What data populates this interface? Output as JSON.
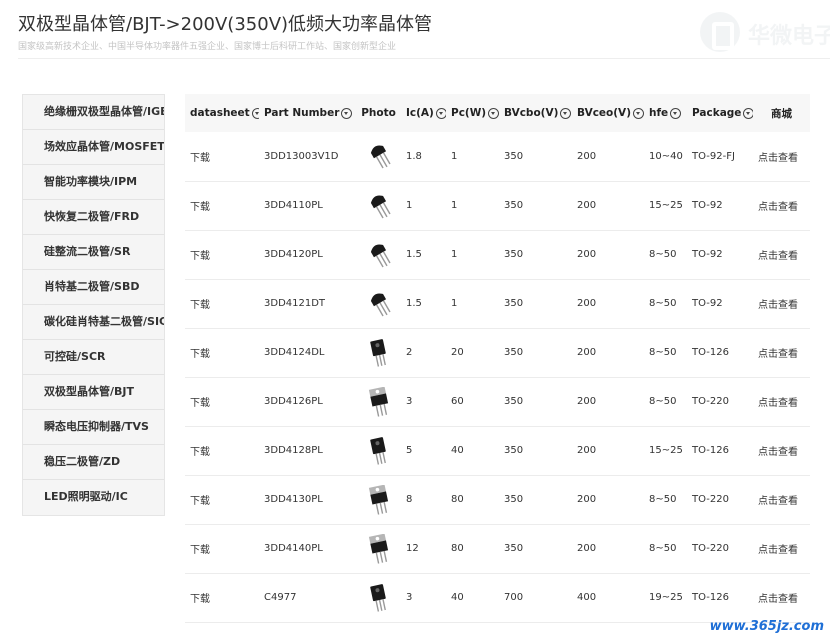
{
  "header": {
    "title": "双极型晶体管/BJT->200V(350V)低频大功率晶体管",
    "subtitle": "国家级高新技术企业、中国半导体功率器件五强企业、国家博士后科研工作站、国家创新型企业",
    "brand_text": "华微电子"
  },
  "sidebar": {
    "items": [
      {
        "label": "绝缘栅双极型晶体管/IGBT"
      },
      {
        "label": "场效应晶体管/MOSFET"
      },
      {
        "label": "智能功率模块/IPM"
      },
      {
        "label": "快恢复二极管/FRD"
      },
      {
        "label": "硅整流二极管/SR"
      },
      {
        "label": "肖特基二极管/SBD"
      },
      {
        "label": "碳化硅肖特基二极管/SIC"
      },
      {
        "label": "可控硅/SCR"
      },
      {
        "label": "双极型晶体管/BJT"
      },
      {
        "label": "瞬态电压抑制器/TVS"
      },
      {
        "label": "稳压二极管/ZD"
      },
      {
        "label": "LED照明驱动/IC"
      }
    ]
  },
  "table": {
    "columns": {
      "datasheet": "datasheet",
      "part_number": "Part Number",
      "photo": "Photo",
      "ic": "Ic(A)",
      "pc": "Pc(W)",
      "bvcbo": "BVcbo(V)",
      "bvceo": "BVceo(V)",
      "hfe": "hfe",
      "package": "Package",
      "shop": "商城"
    },
    "rows": [
      {
        "datasheet": "下载",
        "part": "3DD13003V1D",
        "photo": "to92-icon",
        "ic": "1.8",
        "pc": "1",
        "bvcbo": "350",
        "bvceo": "200",
        "hfe": "10~40",
        "package": "TO-92-FJ",
        "shop": "点击查看"
      },
      {
        "datasheet": "下载",
        "part": "3DD4110PL",
        "photo": "to92-icon",
        "ic": "1",
        "pc": "1",
        "bvcbo": "350",
        "bvceo": "200",
        "hfe": "15~25",
        "package": "TO-92",
        "shop": "点击查看"
      },
      {
        "datasheet": "下载",
        "part": "3DD4120PL",
        "photo": "to92-icon",
        "ic": "1.5",
        "pc": "1",
        "bvcbo": "350",
        "bvceo": "200",
        "hfe": "8~50",
        "package": "TO-92",
        "shop": "点击查看"
      },
      {
        "datasheet": "下载",
        "part": "3DD4121DT",
        "photo": "to92-icon",
        "ic": "1.5",
        "pc": "1",
        "bvcbo": "350",
        "bvceo": "200",
        "hfe": "8~50",
        "package": "TO-92",
        "shop": "点击查看"
      },
      {
        "datasheet": "下载",
        "part": "3DD4124DL",
        "photo": "to126-icon",
        "ic": "2",
        "pc": "20",
        "bvcbo": "350",
        "bvceo": "200",
        "hfe": "8~50",
        "package": "TO-126",
        "shop": "点击查看"
      },
      {
        "datasheet": "下载",
        "part": "3DD4126PL",
        "photo": "to220-icon",
        "ic": "3",
        "pc": "60",
        "bvcbo": "350",
        "bvceo": "200",
        "hfe": "8~50",
        "package": "TO-220",
        "shop": "点击查看"
      },
      {
        "datasheet": "下载",
        "part": "3DD4128PL",
        "photo": "to126-icon",
        "ic": "5",
        "pc": "40",
        "bvcbo": "350",
        "bvceo": "200",
        "hfe": "15~25",
        "package": "TO-126",
        "shop": "点击查看"
      },
      {
        "datasheet": "下载",
        "part": "3DD4130PL",
        "photo": "to220-icon",
        "ic": "8",
        "pc": "80",
        "bvcbo": "350",
        "bvceo": "200",
        "hfe": "8~50",
        "package": "TO-220",
        "shop": "点击查看"
      },
      {
        "datasheet": "下载",
        "part": "3DD4140PL",
        "photo": "to220-icon",
        "ic": "12",
        "pc": "80",
        "bvcbo": "350",
        "bvceo": "200",
        "hfe": "8~50",
        "package": "TO-220",
        "shop": "点击查看"
      },
      {
        "datasheet": "下载",
        "part": "C4977",
        "photo": "to126-icon",
        "ic": "3",
        "pc": "40",
        "bvcbo": "700",
        "bvceo": "400",
        "hfe": "19~25",
        "package": "TO-126",
        "shop": "点击查看"
      }
    ]
  },
  "watermark": {
    "text": "www.365jz.com",
    "color": "#1f6fd6"
  }
}
